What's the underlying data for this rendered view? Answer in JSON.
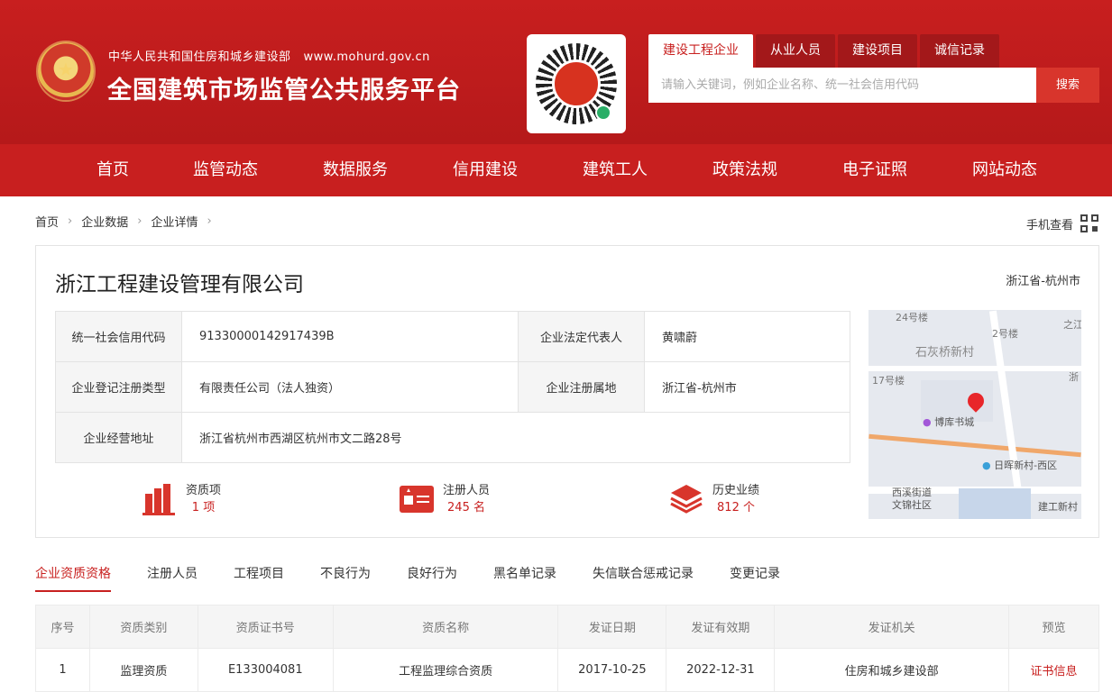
{
  "header": {
    "sub_title": "中华人民共和国住房和城乡建设部",
    "url": "www.mohurd.gov.cn",
    "title": "全国建筑市场监管公共服务平台"
  },
  "search": {
    "tabs": [
      "建设工程企业",
      "从业人员",
      "建设项目",
      "诚信记录"
    ],
    "active_tab": "建设工程企业",
    "placeholder": "请输入关键词，例如企业名称、统一社会信用代码",
    "button": "搜索"
  },
  "nav": {
    "items": [
      "首页",
      "监管动态",
      "数据服务",
      "信用建设",
      "建筑工人",
      "政策法规",
      "电子证照",
      "网站动态"
    ]
  },
  "breadcrumb": [
    "首页",
    "企业数据",
    "企业详情"
  ],
  "mobile_view": "手机查看",
  "company": {
    "name": "浙江工程建设管理有限公司",
    "region": "浙江省-杭州市",
    "info": {
      "credit_code_label": "统一社会信用代码",
      "credit_code": "91330000142917439B",
      "legal_rep_label": "企业法定代表人",
      "legal_rep": "黄啸蔚",
      "reg_type_label": "企业登记注册类型",
      "reg_type": "有限责任公司（法人独资）",
      "reg_place_label": "企业注册属地",
      "reg_place": "浙江省-杭州市",
      "address_label": "企业经营地址",
      "address": "浙江省杭州市西湖区杭州市文二路28号"
    },
    "stats": [
      {
        "label": "资质项",
        "value": "1 项"
      },
      {
        "label": "注册人员",
        "value": "245 名"
      },
      {
        "label": "历史业绩",
        "value": "812 个"
      }
    ]
  },
  "map": {
    "labels": [
      "24号楼",
      "2号楼",
      "之江",
      "石灰桥新村",
      "浙",
      "17号楼",
      "博库书城",
      "日晖新村-西区",
      "西溪街道",
      "文锦社区",
      "建工新村"
    ]
  },
  "detail_tabs": [
    "企业资质资格",
    "注册人员",
    "工程项目",
    "不良行为",
    "良好行为",
    "黑名单记录",
    "失信联合惩戒记录",
    "变更记录"
  ],
  "qualification_table": {
    "headers": [
      "序号",
      "资质类别",
      "资质证书号",
      "资质名称",
      "发证日期",
      "发证有效期",
      "发证机关",
      "预览"
    ],
    "rows": [
      [
        "1",
        "监理资质",
        "E133004081",
        "工程监理综合资质",
        "2017-10-25",
        "2022-12-31",
        "住房和城乡建设部",
        "证书信息"
      ]
    ]
  },
  "colors": {
    "brand_red": "#c81f1f",
    "accent_red": "#d8352c",
    "link_red": "#c8201f"
  }
}
